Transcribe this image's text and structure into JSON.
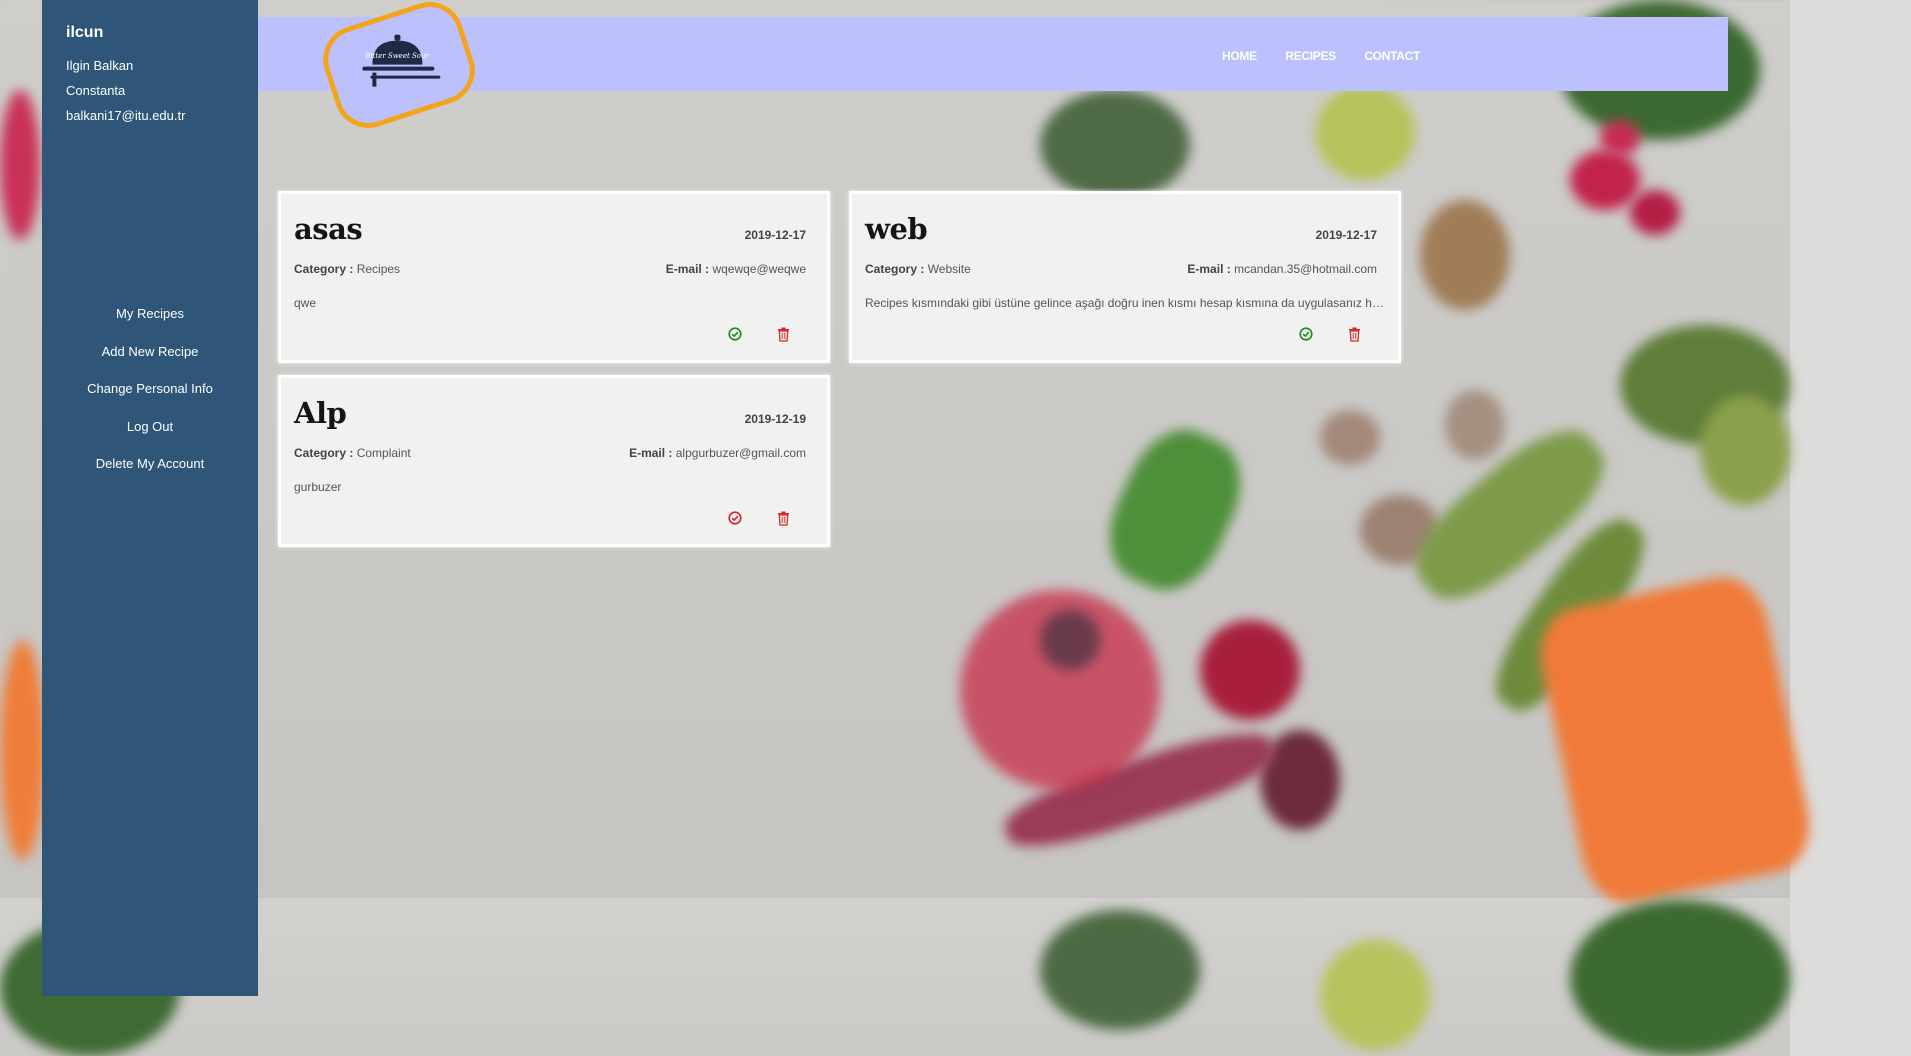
{
  "user": {
    "username": "ilcun",
    "full_name": "Ilgin Balkan",
    "city": "Constanta",
    "email": "balkani17@itu.edu.tr"
  },
  "sidebar": {
    "menu": [
      {
        "label": "My Recipes"
      },
      {
        "label": "Add New Recipe"
      },
      {
        "label": "Change Personal Info"
      },
      {
        "label": "Log Out"
      },
      {
        "label": "Delete My Account"
      }
    ]
  },
  "header": {
    "logo_text": "Bitter Sweet Sour",
    "nav": [
      {
        "label": "HOME"
      },
      {
        "label": "RECIPES"
      },
      {
        "label": "CONTACT"
      }
    ]
  },
  "labels": {
    "category": "Category :",
    "email": "E-mail :"
  },
  "messages": [
    {
      "title": "asas",
      "date": "2019-12-17",
      "category": "Recipes",
      "email": "wqewqe@weqwe",
      "text": "qwe",
      "status_icon": "check-circle-icon",
      "status_color": "#1a8a1a"
    },
    {
      "title": "web",
      "date": "2019-12-17",
      "category": "Website",
      "email": "mcandan.35@hotmail.com",
      "text": "Recipes kısmındaki gibi üstüne gelince aşağı doğru inen kısmı hesap kısmına da uygulasanız hoş…",
      "status_icon": "check-circle-icon",
      "status_color": "#1a8a1a"
    },
    {
      "title": "Alp",
      "date": "2019-12-19",
      "category": "Complaint",
      "email": "alpgurbuzer@gmail.com",
      "text": "gurbuzer",
      "status_icon": "check-circle-icon",
      "status_color": "#d8232a"
    }
  ],
  "colors": {
    "sidebar_bg": "#2f5678",
    "header_bg": "#bcc1fd",
    "logo_border": "#f4a41b",
    "delete_red": "#d8232a"
  }
}
